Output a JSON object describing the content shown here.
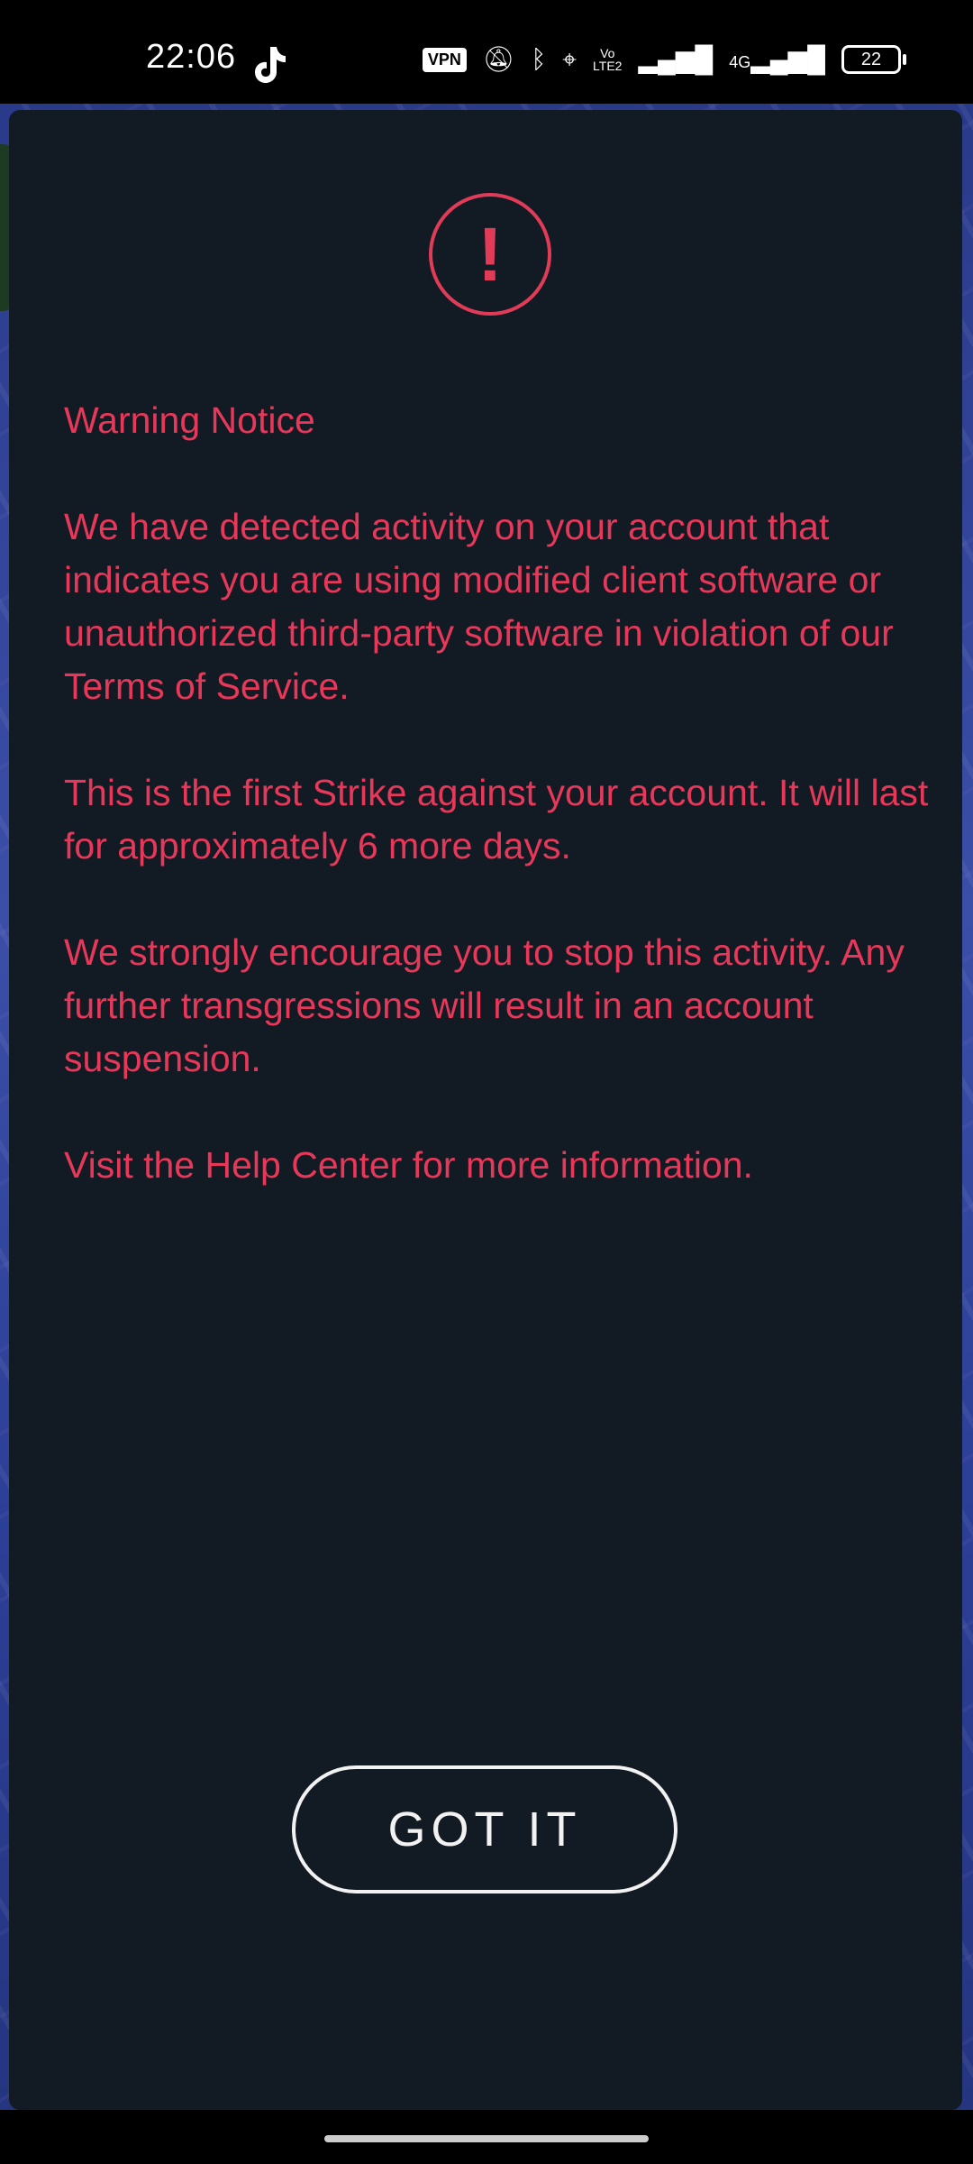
{
  "status_bar": {
    "time": "22:06",
    "app_icon": "tiktok-icon",
    "vpn_label": "VPN",
    "volte_top": "Vo",
    "volte_bottom": "LTE2",
    "network_label": "4G",
    "battery_level": "22"
  },
  "dialog": {
    "icon": "exclamation-circle-icon",
    "icon_glyph": "!",
    "title": "Warning Notice",
    "paragraph1": "We have detected activity on your account that indicates you are using modified client software or unauthorized third-party software in violation of our",
    "terms_link": "Terms of Service.",
    "paragraph2": "This is the first Strike against your account. It will last for approximately 6 more days.",
    "paragraph3": "We strongly encourage you to stop this activity. Any further transgressions will result in an account suspension.",
    "help_prefix": "Visit the",
    "help_link": "Help Center",
    "help_suffix": "for more information.",
    "button_label": "GOT IT"
  },
  "colors": {
    "dialog_bg": "#121a23",
    "warning_text": "#e8385a",
    "button_border": "#f2f2f2"
  }
}
